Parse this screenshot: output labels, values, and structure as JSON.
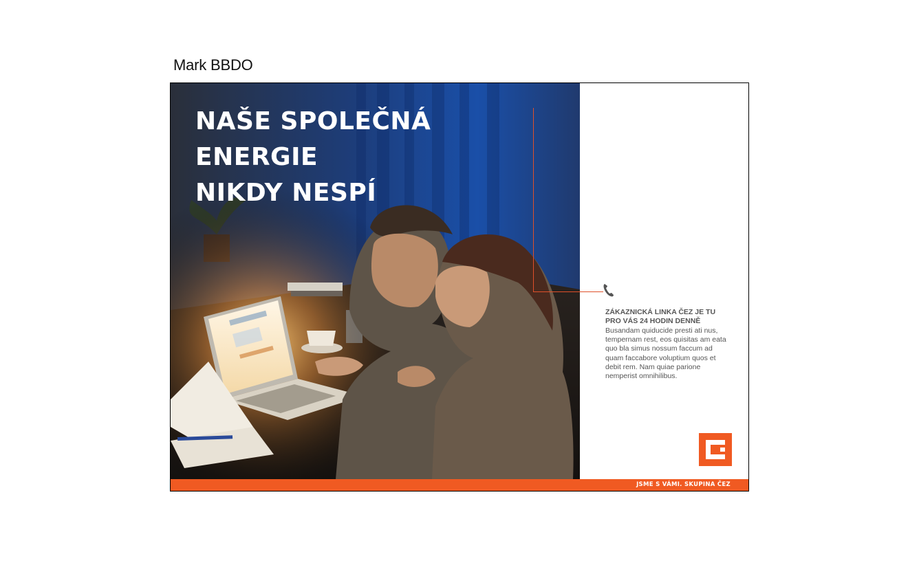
{
  "agency_label": "Mark BBDO",
  "ad": {
    "headline_lines": [
      "NAŠE SPOLEČNÁ",
      "ENERGIE",
      "NIKDY NESPÍ"
    ],
    "info_title": "ZÁKAZNICKÁ LINKA ČEZ JE TU PRO VÁS 24 HODIN DENNĚ",
    "info_body": "Busandam quiducide presti ati nus, tempernam rest, eos quisitas am eata quo bla simus nossum faccum ad quam faccabore voluptium quos et debit rem. Nam quiae parione nemperist omnihilibus.",
    "slogan": "JSME S VÁMI. SKUPINA ČEZ",
    "photo_description_icon": "phone-icon",
    "colors": {
      "brand_orange": "#f05a22",
      "callout_line": "#e0502a",
      "text_gray": "#555555"
    }
  }
}
